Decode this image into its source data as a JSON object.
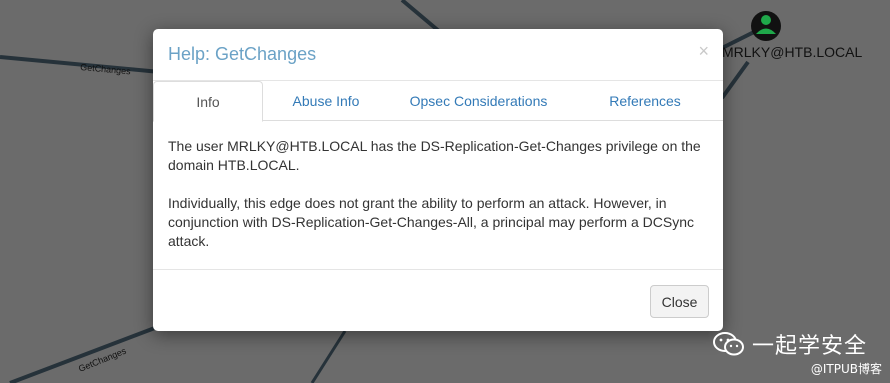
{
  "graph": {
    "edge_labels": [
      "GetChanges",
      "GetChanges"
    ],
    "node_label": "MRLKY@HTB.LOCAL"
  },
  "modal": {
    "title": "Help: GetChanges",
    "close_glyph": "×",
    "tabs": [
      {
        "label": "Info",
        "active": true
      },
      {
        "label": "Abuse Info",
        "active": false
      },
      {
        "label": "Opsec Considerations",
        "active": false
      },
      {
        "label": "References",
        "active": false
      }
    ],
    "content": {
      "paragraph1": "The user MRLKY@HTB.LOCAL has the DS-Replication-Get-Changes privilege on the domain HTB.LOCAL.",
      "paragraph2": "Individually, this edge does not grant the ability to perform an attack. However, in conjunction with DS-Replication-Get-Changes-All, a principal may perform a DCSync attack."
    },
    "footer": {
      "close_label": "Close"
    }
  },
  "watermark": {
    "main": "一起学安全",
    "sub": "@ITPUB博客"
  },
  "colors": {
    "backdrop": "#6b6b6b",
    "title": "#6ba2c6",
    "link": "#337ab7",
    "node_green": "#1fa84a"
  }
}
